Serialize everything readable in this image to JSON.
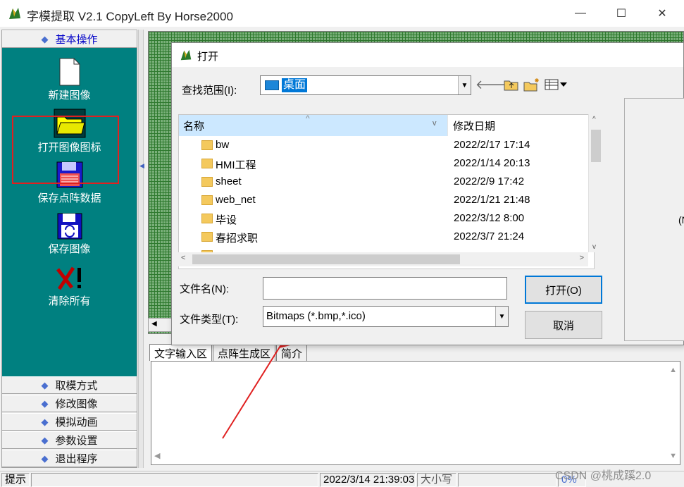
{
  "window": {
    "title": "字模提取 V2.1  CopyLeft By Horse2000",
    "minimize": "—",
    "maximize": "☐",
    "close": "✕"
  },
  "sidebar": {
    "top_section": "基本操作",
    "tools": [
      {
        "label": "新建图像",
        "icon": "new-document-icon"
      },
      {
        "label": "打开图像图标",
        "icon": "open-folder-icon"
      },
      {
        "label": "保存点阵数据",
        "icon": "save-data-icon"
      },
      {
        "label": "保存图像",
        "icon": "save-image-icon"
      },
      {
        "label": "清除所有",
        "icon": "clear-all-icon"
      }
    ],
    "sections": [
      "取模方式",
      "修改图像",
      "模拟动画",
      "参数设置",
      "退出程序"
    ]
  },
  "tabs": [
    "文字输入区",
    "点阵生成区",
    "简介"
  ],
  "status": {
    "hint": "提示",
    "datetime": "2022/3/14 21:39:03",
    "caps": "大小写",
    "percent": "0%",
    "watermark": "CSDN @桃成蹊2.0"
  },
  "dialog": {
    "title": "打开",
    "lookin_label": "查找范围(I):",
    "lookin_value": "桌面",
    "col_name": "名称",
    "col_date": "修改日期",
    "files": [
      {
        "name": "bw",
        "date": "2022/2/17 17:14"
      },
      {
        "name": "HMI工程",
        "date": "2022/1/14 20:13"
      },
      {
        "name": "sheet",
        "date": "2022/2/9 17:42"
      },
      {
        "name": "web_net",
        "date": "2022/1/21 21:48"
      },
      {
        "name": "毕设",
        "date": "2022/3/12 8:00"
      },
      {
        "name": "春招求职",
        "date": "2022/3/7 21:24"
      }
    ],
    "filename_label": "文件名(N):",
    "filename_value": "",
    "filetype_label": "文件类型(T):",
    "filetype_value": "Bitmaps (*.bmp,*.ico)",
    "open_button": "打开(O)",
    "cancel_button": "取消",
    "preview_text": "(N"
  },
  "colors": {
    "teal": "#008080",
    "highlight": "#0078d7",
    "annotation_red": "#e02020"
  }
}
